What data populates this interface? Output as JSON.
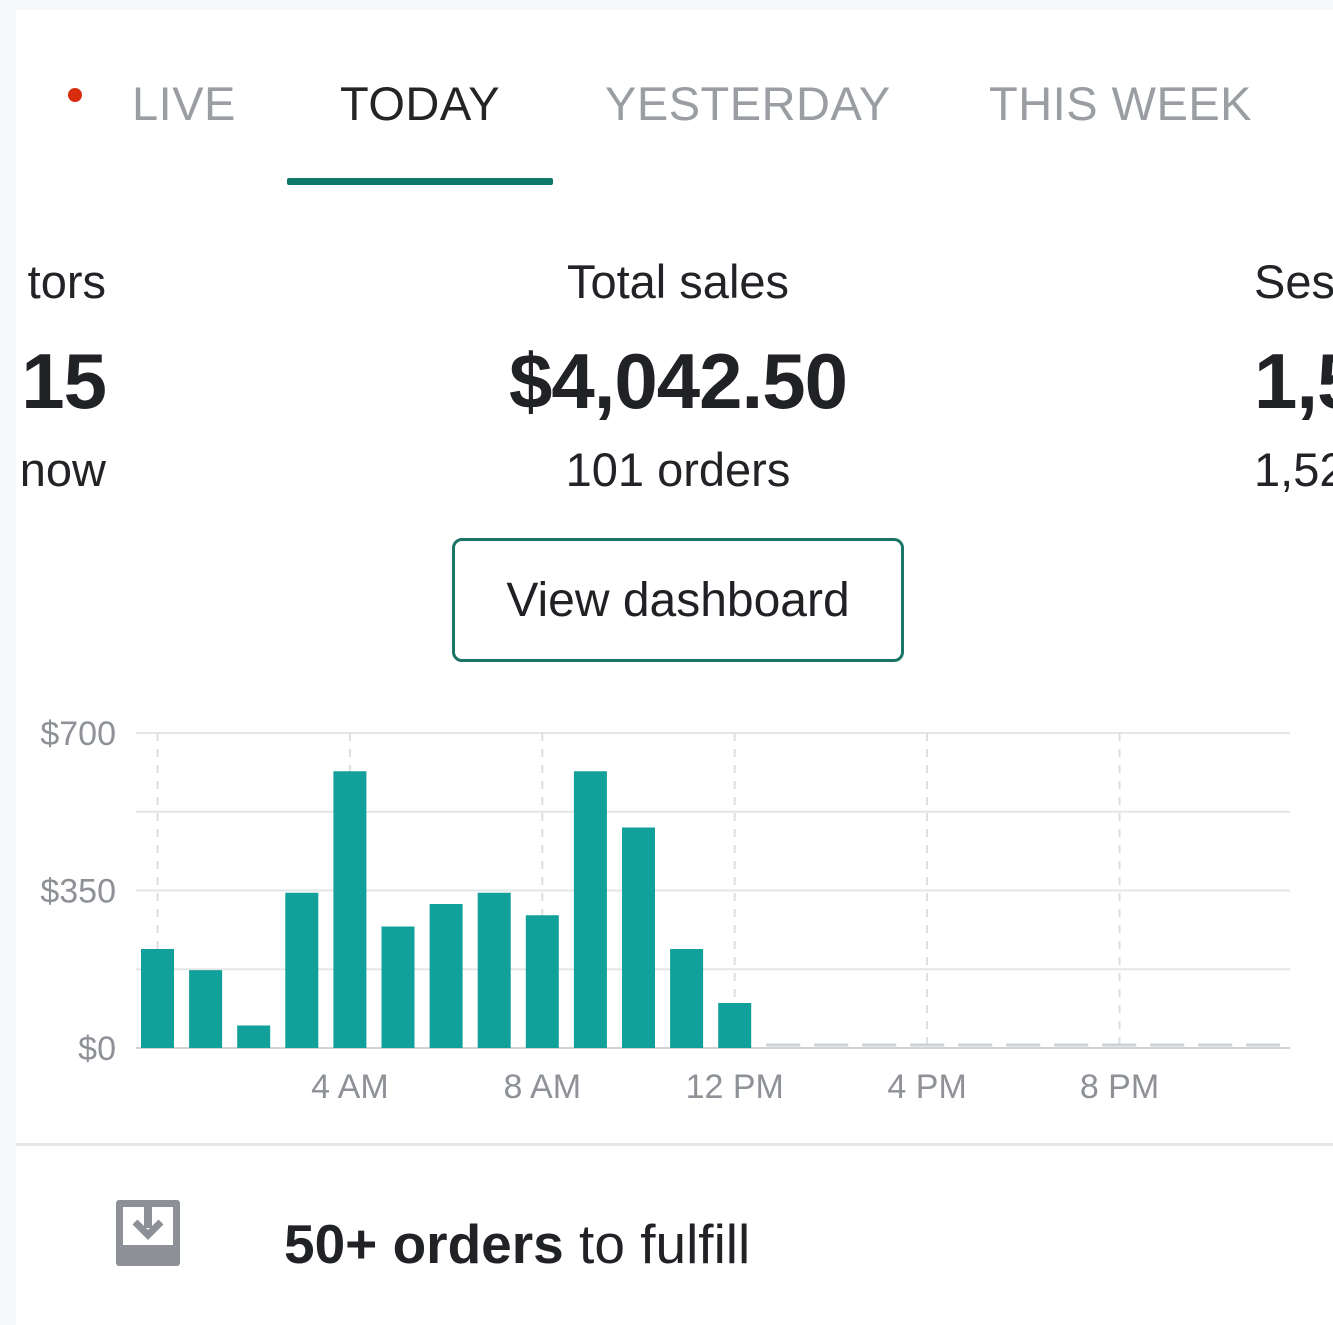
{
  "tabs": [
    {
      "label": "LIVE",
      "indicator": "live-dot",
      "active": false
    },
    {
      "label": "TODAY",
      "active": true
    },
    {
      "label": "YESTERDAY",
      "active": false
    },
    {
      "label": "THIS WEEK",
      "active": false
    }
  ],
  "metrics": {
    "left": {
      "label": "tors",
      "value": "15",
      "sub": "now"
    },
    "center": {
      "label": "Total sales",
      "value": "$4,042.50",
      "sub": "101 orders"
    },
    "right": {
      "label": "Ses",
      "value": "1,5",
      "sub": "1,52"
    }
  },
  "button": {
    "label": "View dashboard"
  },
  "chart_data": {
    "type": "bar",
    "x_ticks": [
      "4 AM",
      "8 AM",
      "12 PM",
      "4 PM",
      "8 PM"
    ],
    "y_ticks": [
      "$0",
      "$350",
      "$700"
    ],
    "ylim": [
      0,
      700
    ],
    "grid": true,
    "hours": [
      0,
      1,
      2,
      3,
      4,
      5,
      6,
      7,
      8,
      9,
      10,
      11,
      12
    ],
    "values": [
      220,
      173,
      50,
      345,
      615,
      270,
      320,
      345,
      295,
      615,
      490,
      220,
      100
    ],
    "bar_color": "#12a09a",
    "empty_hours_from": 13,
    "empty_hours_to": 23
  },
  "footer": {
    "icon": "inbox-download-icon",
    "count_text": "50+ orders",
    "rest_text": " to fulfill"
  },
  "colors": {
    "accent": "#0f7a69",
    "live": "#d72c0d",
    "bar": "#12a09a"
  }
}
